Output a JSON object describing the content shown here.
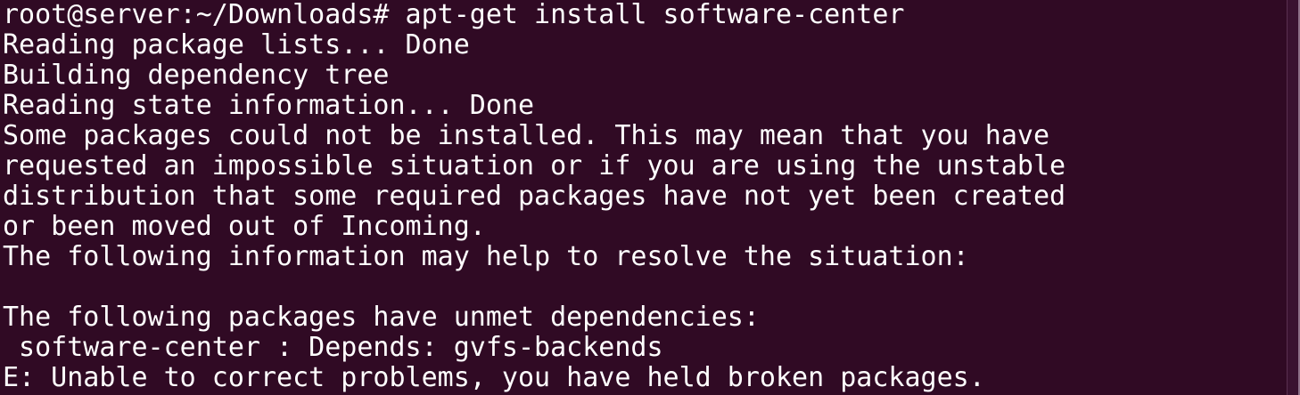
{
  "terminal": {
    "lines": [
      "root@server:~/Downloads# apt-get install software-center",
      "Reading package lists... Done",
      "Building dependency tree",
      "Reading state information... Done",
      "Some packages could not be installed. This may mean that you have",
      "requested an impossible situation or if you are using the unstable",
      "distribution that some required packages have not yet been created",
      "or been moved out of Incoming.",
      "The following information may help to resolve the situation:",
      "",
      "The following packages have unmet dependencies:",
      " software-center : Depends: gvfs-backends",
      "E: Unable to correct problems, you have held broken packages."
    ]
  },
  "colors": {
    "background": "#300a24",
    "text": "#ffffff"
  }
}
